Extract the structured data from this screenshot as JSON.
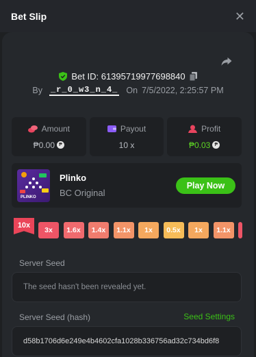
{
  "header": {
    "title": "Bet Slip",
    "close_icon": "close-icon"
  },
  "bet": {
    "id_label": "Bet ID: 61395719977698840",
    "by_label": "By",
    "user": "_r_0_w3_n_4_",
    "on_label": "On",
    "date": "7/5/2022, 2:25:57 PM"
  },
  "stats": {
    "amount": {
      "label": "Amount",
      "value": "₱0.00",
      "icon": "coins-icon"
    },
    "payout": {
      "label": "Payout",
      "value": "10 x",
      "icon": "wallet-icon"
    },
    "profit": {
      "label": "Profit",
      "value": "₱0.03",
      "icon": "profit-icon"
    }
  },
  "game": {
    "name": "Plinko",
    "subtitle": "BC Original",
    "play_label": "Play Now",
    "thumb_text": "PLINKO"
  },
  "multipliers": {
    "selected": "10x",
    "chips": [
      "3x",
      "1.6x",
      "1.4x",
      "1.1x",
      "1x",
      "0.5x",
      "1x",
      "1.1x"
    ]
  },
  "server_seed": {
    "label": "Server Seed",
    "value": "The seed hasn't been revealed yet.",
    "hash_label": "Server Seed (hash)",
    "settings_label": "Seed Settings",
    "hash_value": "d58b1706d6e249e4b4602cfa1028b336756ad32c734bd6f8"
  },
  "colors": {
    "accent_green": "#3bc117",
    "profit_green": "#5ed424",
    "flag_red": "#ea4559"
  }
}
